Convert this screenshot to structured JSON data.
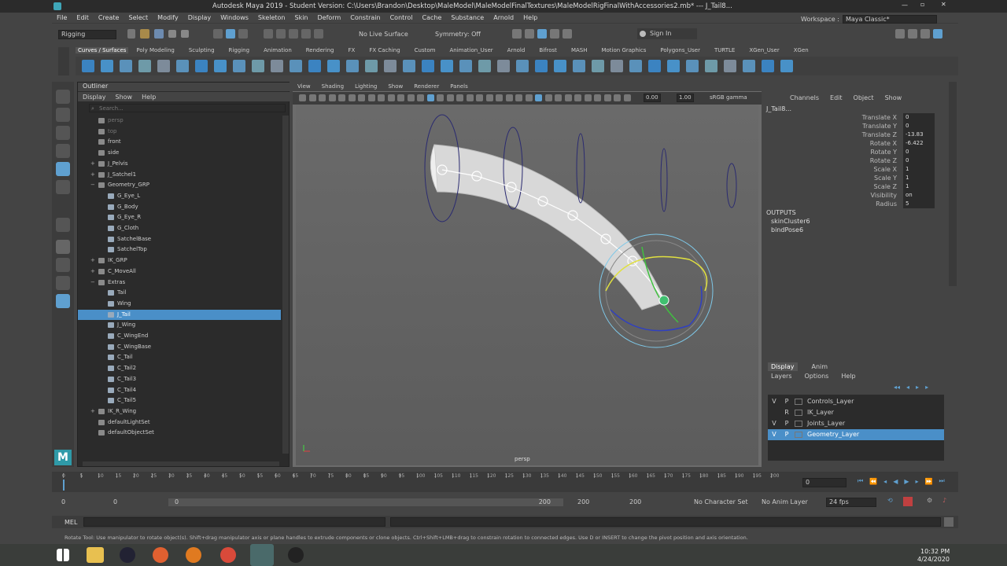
{
  "title": "Autodesk Maya 2019 - Student Version: C:\\Users\\Brandon\\Desktop\\MaleModel\\MaleModelFinalTextures\\MaleModelRigFinalWithAccessories2.mb*  ---  J_Tail8...",
  "menus": [
    "File",
    "Edit",
    "Create",
    "Select",
    "Modify",
    "Display",
    "Windows",
    "Skeleton",
    "Skin",
    "Deform",
    "Constrain",
    "Control",
    "Cache",
    "Substance",
    "Arnold",
    "Help"
  ],
  "workspace": {
    "label": "Workspace :",
    "value": "Maya Classic*"
  },
  "status": {
    "menuset": "Rigging",
    "live_surface": "No Live Surface",
    "symmetry": "Symmetry: Off",
    "sign_in": "Sign In"
  },
  "shelf_tabs": [
    "Curves / Surfaces",
    "Poly Modeling",
    "Sculpting",
    "Rigging",
    "Animation",
    "Rendering",
    "FX",
    "FX Caching",
    "Custom",
    "Animation_User",
    "Arnold",
    "Bifrost",
    "MASH",
    "Motion Graphics",
    "Polygons_User",
    "TURTLE",
    "XGen_User",
    "XGen"
  ],
  "outliner": {
    "title": "Outliner",
    "menus": [
      "Display",
      "Show",
      "Help"
    ],
    "search_placeholder": "Search...",
    "items": [
      {
        "label": "persp",
        "indent": 0,
        "dim": true
      },
      {
        "label": "top",
        "indent": 0,
        "dim": true
      },
      {
        "label": "front",
        "indent": 0
      },
      {
        "label": "side",
        "indent": 0
      },
      {
        "label": "J_Pelvis",
        "indent": 0,
        "exp": "+"
      },
      {
        "label": "J_Satchel1",
        "indent": 0,
        "exp": "+"
      },
      {
        "label": "Geometry_GRP",
        "indent": 0,
        "exp": "−"
      },
      {
        "label": "G_Eye_L",
        "indent": 1
      },
      {
        "label": "G_Body",
        "indent": 1
      },
      {
        "label": "G_Eye_R",
        "indent": 1
      },
      {
        "label": "G_Cloth",
        "indent": 1
      },
      {
        "label": "SatchelBase",
        "indent": 1
      },
      {
        "label": "SatchelTop",
        "indent": 1
      },
      {
        "label": "IK_GRP",
        "indent": 0,
        "exp": "+"
      },
      {
        "label": "C_MoveAll",
        "indent": 0,
        "exp": "+"
      },
      {
        "label": "Extras",
        "indent": 0,
        "exp": "−"
      },
      {
        "label": "Tail",
        "indent": 1
      },
      {
        "label": "Wing",
        "indent": 1
      },
      {
        "label": "J_Tail",
        "indent": 1,
        "selected": true
      },
      {
        "label": "J_Wing",
        "indent": 1
      },
      {
        "label": "C_WingEnd",
        "indent": 1
      },
      {
        "label": "C_WingBase",
        "indent": 1
      },
      {
        "label": "C_Tail",
        "indent": 1
      },
      {
        "label": "C_Tail2",
        "indent": 1
      },
      {
        "label": "C_Tail3",
        "indent": 1
      },
      {
        "label": "C_Tail4",
        "indent": 1
      },
      {
        "label": "C_Tail5",
        "indent": 1
      },
      {
        "label": "IK_R_Wing",
        "indent": 0,
        "exp": "+"
      },
      {
        "label": "defaultLightSet",
        "indent": 0
      },
      {
        "label": "defaultObjectSet",
        "indent": 0
      }
    ]
  },
  "viewport": {
    "menus": [
      "View",
      "Shading",
      "Lighting",
      "Show",
      "Renderer",
      "Panels"
    ],
    "field1": "0.00",
    "field2": "1.00",
    "color": "sRGB gamma",
    "camera": "persp"
  },
  "channelbox": {
    "menus": [
      "Channels",
      "Edit",
      "Object",
      "Show"
    ],
    "object": "J_Tail8...",
    "attrs": [
      {
        "label": "Translate X",
        "value": "0"
      },
      {
        "label": "Translate Y",
        "value": "0"
      },
      {
        "label": "Translate Z",
        "value": "-13.83"
      },
      {
        "label": "Rotate X",
        "value": "-6.422"
      },
      {
        "label": "Rotate Y",
        "value": "0"
      },
      {
        "label": "Rotate Z",
        "value": "0"
      },
      {
        "label": "Scale X",
        "value": "1"
      },
      {
        "label": "Scale Y",
        "value": "1"
      },
      {
        "label": "Scale Z",
        "value": "1"
      },
      {
        "label": "Visibility",
        "value": "on"
      },
      {
        "label": "Radius",
        "value": "5"
      }
    ],
    "outputs_title": "OUTPUTS",
    "outputs": [
      "skinCluster6",
      "bindPose6"
    ]
  },
  "layers": {
    "tabs": [
      "Display",
      "Anim"
    ],
    "menus": [
      "Layers",
      "Options",
      "Help"
    ],
    "rows": [
      {
        "v": "V",
        "p": "P",
        "name": "Controls_Layer"
      },
      {
        "v": "",
        "p": "R",
        "name": "IK_Layer"
      },
      {
        "v": "V",
        "p": "P",
        "name": "Joints_Layer"
      },
      {
        "v": "V",
        "p": "P",
        "name": "Geometry_Layer",
        "selected": true
      }
    ]
  },
  "timeline": {
    "ticks": [
      "0",
      "5",
      "10",
      "15",
      "20",
      "25",
      "30",
      "35",
      "40",
      "45",
      "50",
      "55",
      "60",
      "65",
      "70",
      "75",
      "80",
      "85",
      "90",
      "95",
      "100",
      "105",
      "110",
      "115",
      "120",
      "125",
      "130",
      "135",
      "140",
      "145",
      "150",
      "155",
      "160",
      "165",
      "170",
      "175",
      "180",
      "185",
      "190",
      "195",
      "200"
    ],
    "current": "0"
  },
  "range": {
    "start": "0",
    "inner_start": "0",
    "slider_start": "0",
    "slider_end": "200",
    "inner_end": "200",
    "end": "200",
    "char_set": "No Character Set",
    "anim_layer": "No Anim Layer",
    "fps": "24 fps"
  },
  "mel": {
    "label": "MEL"
  },
  "helpline": "Rotate Tool: Use manipulator to rotate object(s). Shift+drag manipulator axis or plane handles to extrude components or clone objects. Ctrl+Shift+LMB+drag to constrain rotation to connected edges. Use D or INSERT to change the pivot position and axis orientation.",
  "clock": {
    "time": "10:32 PM",
    "date": "4/24/2020"
  },
  "colors": {
    "selection": "#4a8fc8",
    "accent": "#5fa0d0"
  }
}
